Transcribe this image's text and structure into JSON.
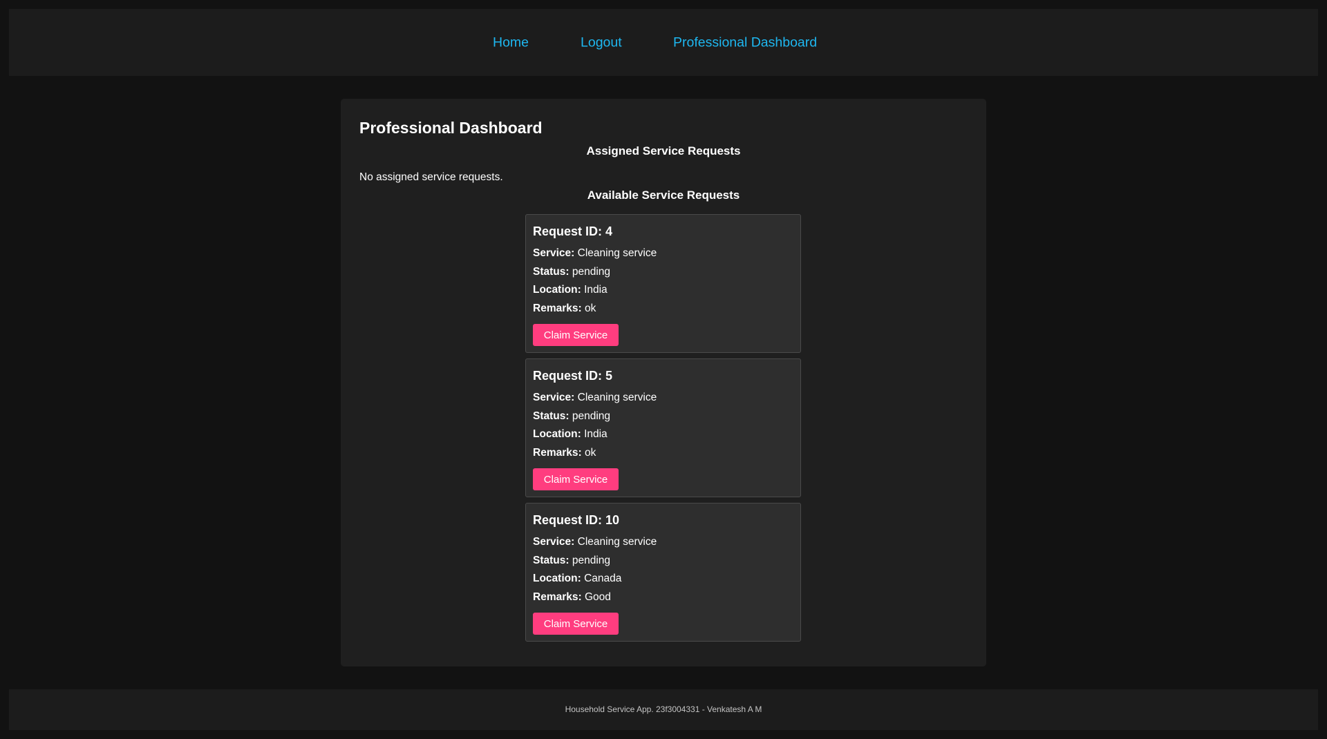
{
  "nav": {
    "home": "Home",
    "logout": "Logout",
    "dashboard": "Professional Dashboard"
  },
  "main": {
    "title": "Professional Dashboard",
    "assigned_heading": "Assigned Service Requests",
    "assigned_empty": "No assigned service requests.",
    "available_heading": "Available Service Requests"
  },
  "labels": {
    "service": "Service:",
    "status": "Status:",
    "location": "Location:",
    "remarks": "Remarks:",
    "claim": "Claim Service"
  },
  "requests": [
    {
      "title": "Request ID: 4",
      "service": "Cleaning service",
      "status": "pending",
      "location": "India",
      "remarks": "ok"
    },
    {
      "title": "Request ID: 5",
      "service": "Cleaning service",
      "status": "pending",
      "location": "India",
      "remarks": "ok"
    },
    {
      "title": "Request ID: 10",
      "service": "Cleaning service",
      "status": "pending",
      "location": "Canada",
      "remarks": "Good"
    }
  ],
  "footer": {
    "text": "Household Service App. 23f3004331 - Venkatesh A M"
  },
  "colors": {
    "background": "#121212",
    "panel": "#1f1f1f",
    "card": "#2e2e2e",
    "link": "#1eb7f0",
    "button": "#ff3d7f"
  }
}
